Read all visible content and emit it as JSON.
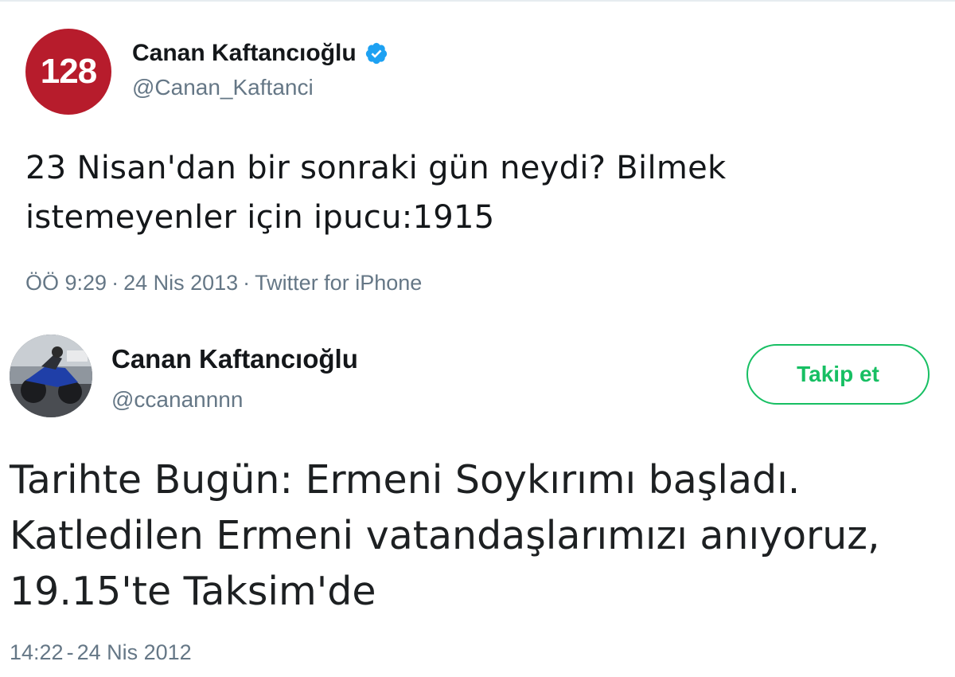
{
  "tweet1": {
    "avatar_text": "128",
    "display_name": "Canan Kaftancıoğlu",
    "verified_icon": "verified-badge-icon",
    "handle": "@Canan_Kaftanci",
    "text_line1": "23 Nisan'dan bir sonraki gün neydi? Bilmek",
    "text_line2": "istemeyenler için ipucu:1915",
    "time": "ÖÖ 9:29",
    "separator": "·",
    "date": "24 Nis 2013",
    "source": "Twitter for iPhone"
  },
  "tweet2": {
    "avatar_icon": "motorcycle-photo-avatar",
    "display_name": "Canan Kaftancıoğlu",
    "handle": "@ccanannnn",
    "follow_label": "Takip et",
    "text_line1": "Tarihte Bugün: Ermeni Soykırımı başladı.",
    "text_line2": "Katledilen Ermeni vatandaşlarımızı anıyoruz,",
    "text_line3": "19.15'te Taksim'de",
    "time": "14:22",
    "separator": "-",
    "date": "24 Nis 2012"
  },
  "colors": {
    "avatar_red": "#b71c2c",
    "verified_blue": "#1da1f2",
    "follow_green": "#17bf63",
    "muted_gray": "#657786"
  }
}
